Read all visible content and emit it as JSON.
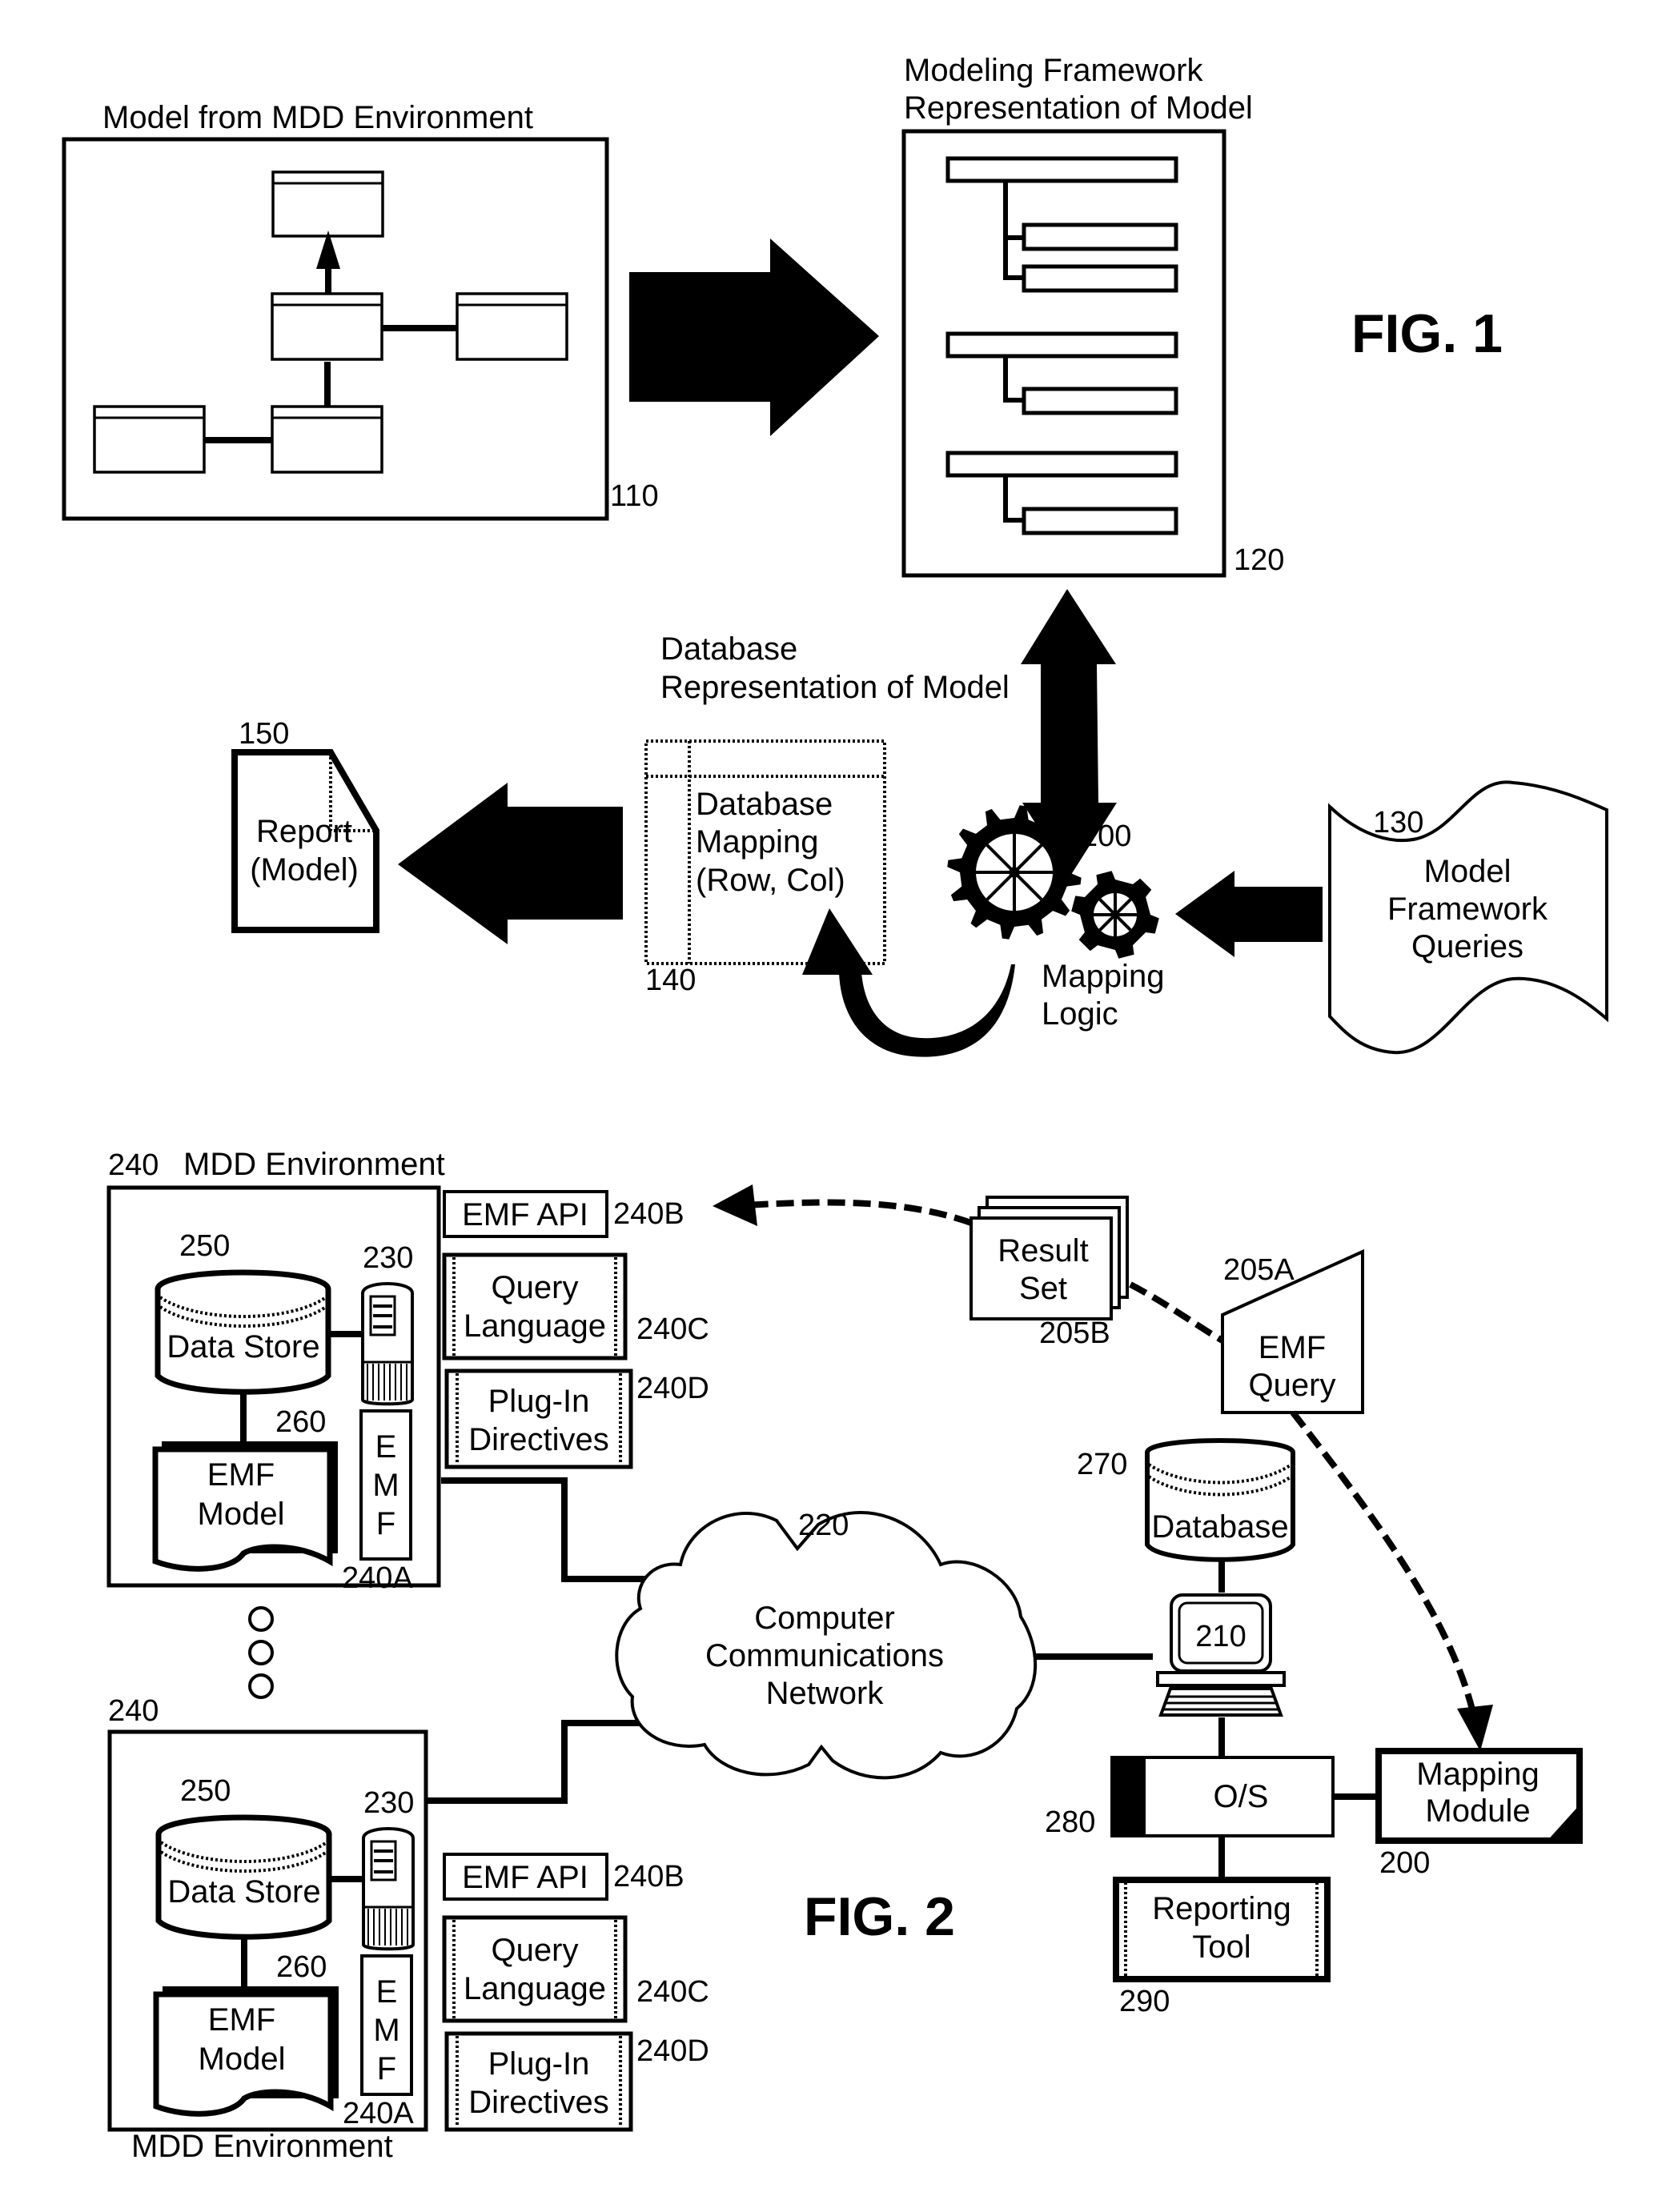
{
  "fig1": {
    "title": "FIG. 1",
    "mdd_model": {
      "caption": "Model from MDD Environment",
      "ref": "110"
    },
    "framework_rep": {
      "caption_line1": "Modeling Framework",
      "caption_line2": "Representation of Model",
      "ref": "120"
    },
    "database_rep": {
      "caption_line1": "Database",
      "caption_line2": "Representation of Model"
    },
    "db_mapping": {
      "line1": "Database",
      "line2": "Mapping",
      "line3": "(Row, Col)",
      "ref": "140"
    },
    "report": {
      "line1": "Report",
      "line2": "(Model)",
      "ref": "150"
    },
    "mapping_logic": {
      "line1": "Mapping",
      "line2": "Logic",
      "ref": "200",
      "icon": "gears-icon"
    },
    "queries": {
      "line1": "Model",
      "line2": "Framework",
      "line3": "Queries",
      "ref": "130"
    }
  },
  "fig2": {
    "title": "FIG. 2",
    "env_top": {
      "ref": "240",
      "caption": "MDD Environment",
      "data_store": {
        "label": "Data Store",
        "ref": "250"
      },
      "device_ref": "230",
      "emf_model": {
        "line1": "EMF",
        "line2": "Model",
        "ref": "260"
      },
      "emf_letters": [
        "E",
        "M",
        "F"
      ],
      "emf_ref": "240A",
      "emf_api": {
        "label": "EMF API",
        "ref": "240B"
      },
      "query_language": {
        "line1": "Query",
        "line2": "Language",
        "ref": "240C"
      },
      "plugin": {
        "line1": "Plug-In",
        "line2": "Directives",
        "ref": "240D"
      }
    },
    "env_bottom": {
      "ref": "240",
      "caption": "MDD Environment",
      "data_store": {
        "label": "Data Store",
        "ref": "250"
      },
      "device_ref": "230",
      "emf_model": {
        "line1": "EMF",
        "line2": "Model",
        "ref": "260"
      },
      "emf_letters": [
        "E",
        "M",
        "F"
      ],
      "emf_ref": "240A",
      "emf_api": {
        "label": "EMF API",
        "ref": "240B"
      },
      "query_language": {
        "line1": "Query",
        "line2": "Language",
        "ref": "240C"
      },
      "plugin": {
        "line1": "Plug-In",
        "line2": "Directives",
        "ref": "240D"
      }
    },
    "network": {
      "line1": "Computer",
      "line2": "Communications",
      "line3": "Network",
      "ref": "220"
    },
    "database": {
      "label": "Database",
      "ref": "270"
    },
    "computer": {
      "ref": "210"
    },
    "os": {
      "label": "O/S",
      "ref": "280"
    },
    "mapping_module": {
      "line1": "Mapping",
      "line2": "Module",
      "ref": "200"
    },
    "reporting_tool": {
      "line1": "Reporting",
      "line2": "Tool",
      "ref": "290"
    },
    "result_set": {
      "line1": "Result",
      "line2": "Set",
      "ref": "205B"
    },
    "emf_query": {
      "line1": "EMF",
      "line2": "Query",
      "ref": "205A"
    }
  }
}
